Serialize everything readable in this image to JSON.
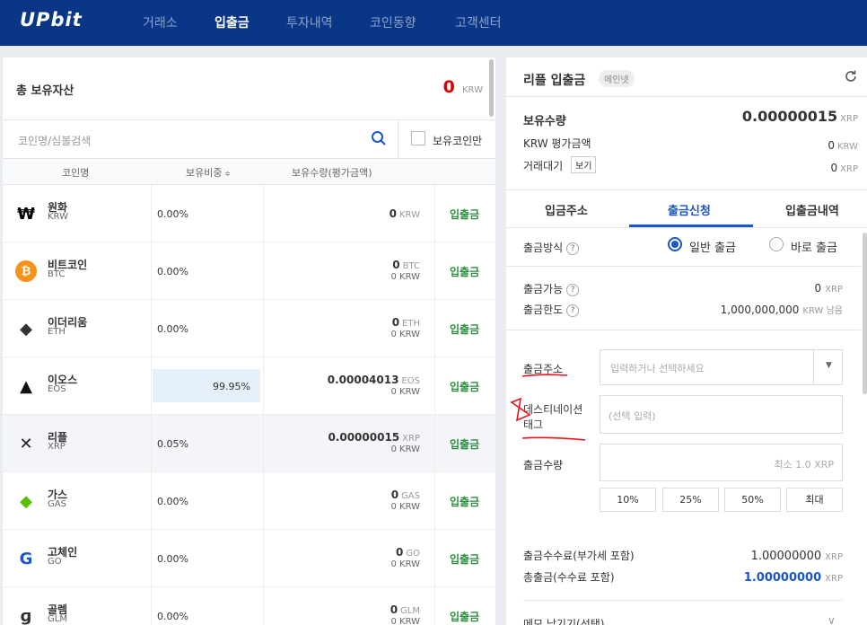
{
  "nav": {
    "logo": "UPbit",
    "items": [
      "거래소",
      "입출금",
      "투자내역",
      "코인동향",
      "고객센터"
    ]
  },
  "left": {
    "total_label": "총 보유자산",
    "total_value": "0",
    "total_unit": "KRW",
    "search_placeholder": "코인명/심볼검색",
    "owned_only_label": "보유코인만",
    "headers": [
      "코인명",
      "보유비중",
      "보유수량(평가금액)"
    ],
    "coins": [
      {
        "name": "원화",
        "symbol": "KRW",
        "pct": "0.00%",
        "balance": "0",
        "unit": "KRW",
        "krw": "",
        "link": "입출금",
        "color": "#000",
        "glyph": "₩"
      },
      {
        "name": "비트코인",
        "symbol": "BTC",
        "pct": "0.00%",
        "balance": "0",
        "unit": "BTC",
        "krw": "0 KRW",
        "link": "입출금",
        "color": "#f7931a",
        "glyph": "₿"
      },
      {
        "name": "이더리움",
        "symbol": "ETH",
        "pct": "0.00%",
        "balance": "0",
        "unit": "ETH",
        "krw": "0 KRW",
        "link": "입출금",
        "color": "#333",
        "glyph": "◆"
      },
      {
        "name": "이오스",
        "symbol": "EOS",
        "pct": "99.95%",
        "balance": "0.00004013",
        "unit": "EOS",
        "krw": "0 KRW",
        "link": "입출금",
        "color": "#111",
        "glyph": "▲"
      },
      {
        "name": "리플",
        "symbol": "XRP",
        "pct": "0.05%",
        "balance": "0.00000015",
        "unit": "XRP",
        "krw": "0 KRW",
        "link": "입출금",
        "color": "#222",
        "glyph": "✕"
      },
      {
        "name": "가스",
        "symbol": "GAS",
        "pct": "0.00%",
        "balance": "0",
        "unit": "GAS",
        "krw": "0 KRW",
        "link": "입출금",
        "color": "#58bf00",
        "glyph": "◆"
      },
      {
        "name": "고체인",
        "symbol": "GO",
        "pct": "0.00%",
        "balance": "0",
        "unit": "GO",
        "krw": "0 KRW",
        "link": "입출금",
        "color": "#1a56c9",
        "glyph": "G"
      },
      {
        "name": "골렘",
        "symbol": "GLM",
        "pct": "0.00%",
        "balance": "0",
        "unit": "GLM",
        "krw": "0 KRW",
        "link": "입출금",
        "color": "#333",
        "glyph": "ɡ"
      }
    ]
  },
  "right": {
    "title": "리플 입출금",
    "badge": "메인넷",
    "holding_label": "보유수량",
    "holding_value": "0.00000015",
    "holding_unit": "XRP",
    "krw_label": "KRW 평가금액",
    "krw_value": "0",
    "krw_unit": "KRW",
    "pending_label": "거래대기",
    "view_label": "보기",
    "pending_value": "0",
    "pending_unit": "XRP",
    "tabs": [
      "입금주소",
      "출금신청",
      "입출금내역"
    ],
    "method_label": "출금방식",
    "method_normal": "일반 출금",
    "method_instant": "바로 출금",
    "avail_label": "출금가능",
    "avail_value": "0",
    "avail_unit": "XRP",
    "limit_label": "출금한도",
    "limit_value": "1,000,000,000",
    "limit_unit": "KRW 남음",
    "addr_label": "출금주소",
    "addr_placeholder": "입력하거나 선택하세요",
    "tag_label1": "데스티네이션",
    "tag_label2": "태그",
    "tag_placeholder": "(선택 입력)",
    "amount_label": "출금수량",
    "amount_placeholder": "최소 1.0 XRP",
    "pct_buttons": [
      "10%",
      "25%",
      "50%",
      "최대"
    ],
    "fee_label": "출금수수료(부가세 포함)",
    "fee_value": "1.00000000",
    "fee_unit": "XRP",
    "total_label": "총출금(수수료 포함)",
    "total_value": "1.00000000",
    "total_unit": "XRP",
    "memo_label": "메모 남기기(선택)"
  }
}
